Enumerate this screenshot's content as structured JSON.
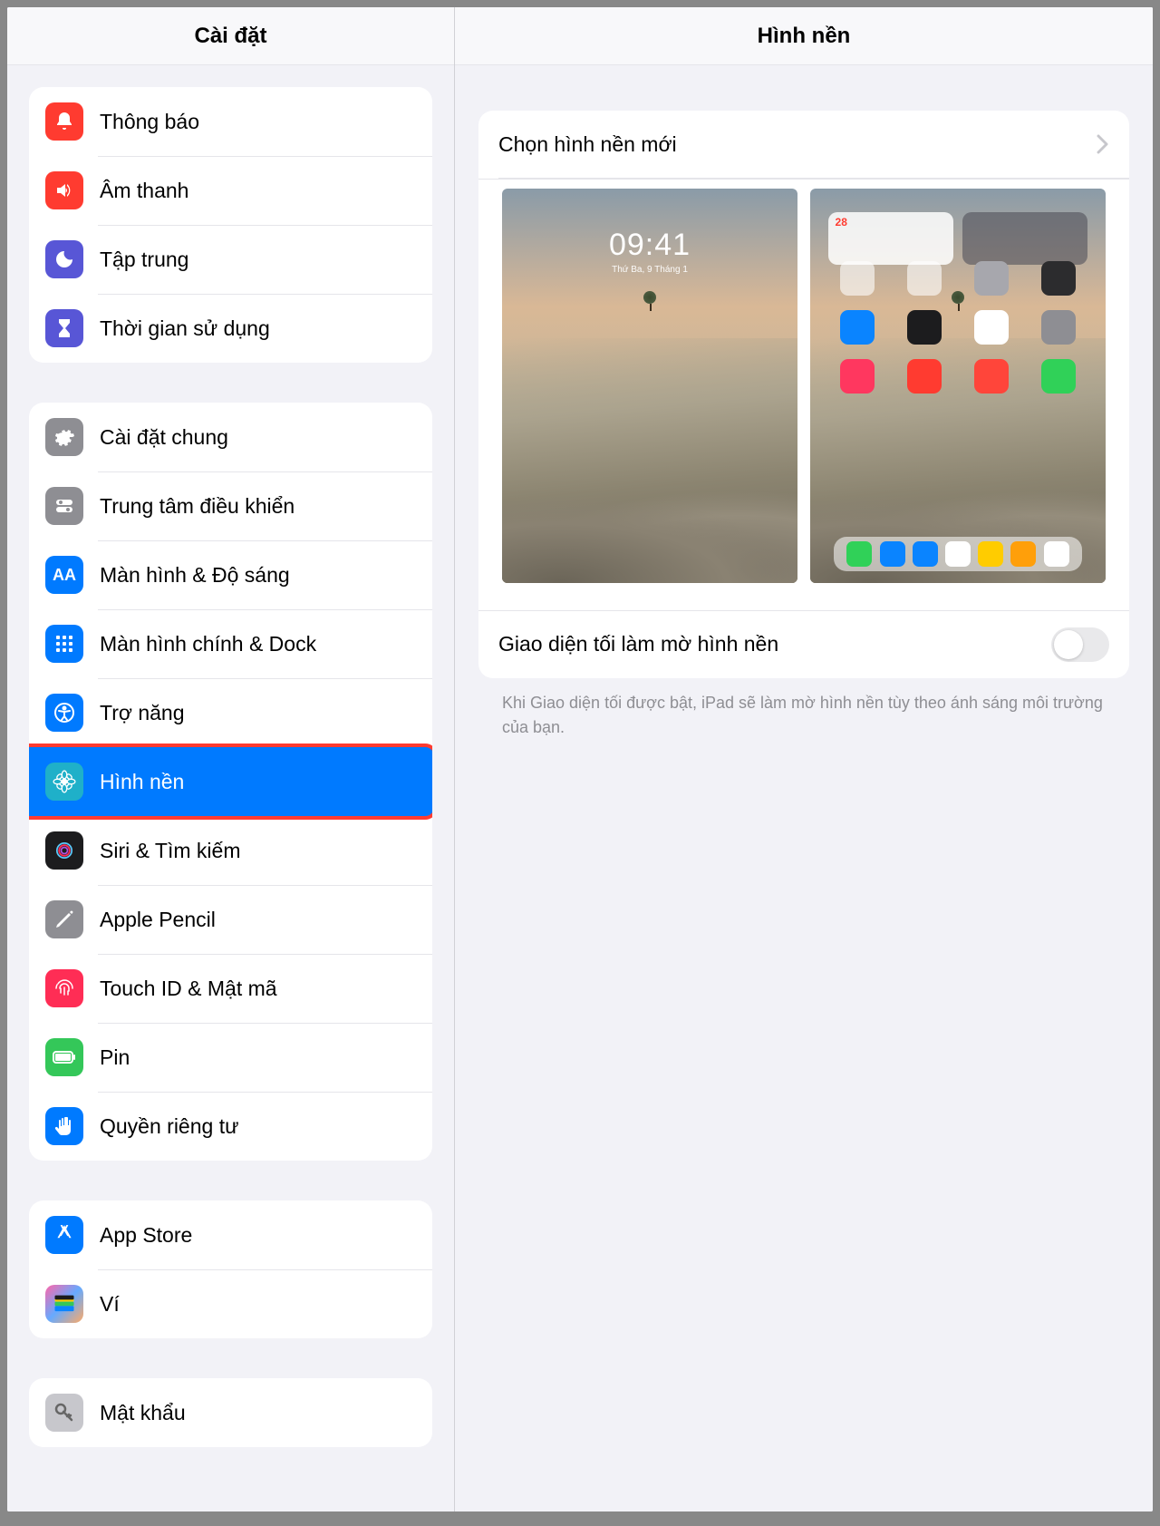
{
  "sidebar": {
    "title": "Cài đặt",
    "groups": [
      {
        "items": [
          {
            "key": "notifications",
            "label": "Thông báo",
            "icon": "bell-icon",
            "bg": "bg-red"
          },
          {
            "key": "sound",
            "label": "Âm thanh",
            "icon": "speaker-icon",
            "bg": "bg-red"
          },
          {
            "key": "focus",
            "label": "Tập trung",
            "icon": "moon-icon",
            "bg": "bg-purple"
          },
          {
            "key": "screentime",
            "label": "Thời gian sử dụng",
            "icon": "hourglass-icon",
            "bg": "bg-purple"
          }
        ]
      },
      {
        "items": [
          {
            "key": "general",
            "label": "Cài đặt chung",
            "icon": "gear-icon",
            "bg": "bg-grey"
          },
          {
            "key": "controlcenter",
            "label": "Trung tâm điều khiển",
            "icon": "toggles-icon",
            "bg": "bg-grey"
          },
          {
            "key": "display",
            "label": "Màn hình & Độ sáng",
            "icon": "text-size-icon",
            "bg": "bg-blue"
          },
          {
            "key": "homescreen",
            "label": "Màn hình chính & Dock",
            "icon": "grid-icon",
            "bg": "bg-blue"
          },
          {
            "key": "accessibility",
            "label": "Trợ năng",
            "icon": "accessibility-icon",
            "bg": "bg-blue"
          },
          {
            "key": "wallpaper",
            "label": "Hình nền",
            "icon": "flower-icon",
            "bg": "bg-cyan",
            "selected": true,
            "highlighted": true
          },
          {
            "key": "siri",
            "label": "Siri & Tìm kiếm",
            "icon": "siri-icon",
            "bg": "bg-black"
          },
          {
            "key": "pencil",
            "label": "Apple Pencil",
            "icon": "pencil-icon",
            "bg": "bg-grey"
          },
          {
            "key": "touchid",
            "label": "Touch ID & Mật mã",
            "icon": "fingerprint-icon",
            "bg": "bg-pink"
          },
          {
            "key": "battery",
            "label": "Pin",
            "icon": "battery-icon",
            "bg": "bg-green"
          },
          {
            "key": "privacy",
            "label": "Quyền riêng tư",
            "icon": "hand-icon",
            "bg": "bg-blue"
          }
        ]
      },
      {
        "items": [
          {
            "key": "appstore",
            "label": "App Store",
            "icon": "appstore-icon",
            "bg": "bg-blue"
          },
          {
            "key": "wallet",
            "label": "Ví",
            "icon": "wallet-icon",
            "bg": "bg-multi"
          }
        ]
      },
      {
        "items": [
          {
            "key": "passwords",
            "label": "Mật khẩu",
            "icon": "key-icon",
            "bg": "bg-greylight"
          }
        ]
      }
    ]
  },
  "detail": {
    "title": "Hình nền",
    "choose_label": "Chọn hình nền mới",
    "lock_preview": {
      "time": "09:41",
      "date": "Thứ Ba, 9 Tháng 1"
    },
    "home_preview": {
      "calendar_day": "28"
    },
    "dim_toggle": {
      "label": "Giao diện tối làm mờ hình nền",
      "on": false
    },
    "footer": "Khi Giao diện tối được bật, iPad sẽ làm mờ hình nền tùy theo ánh sáng môi trường của bạn."
  }
}
